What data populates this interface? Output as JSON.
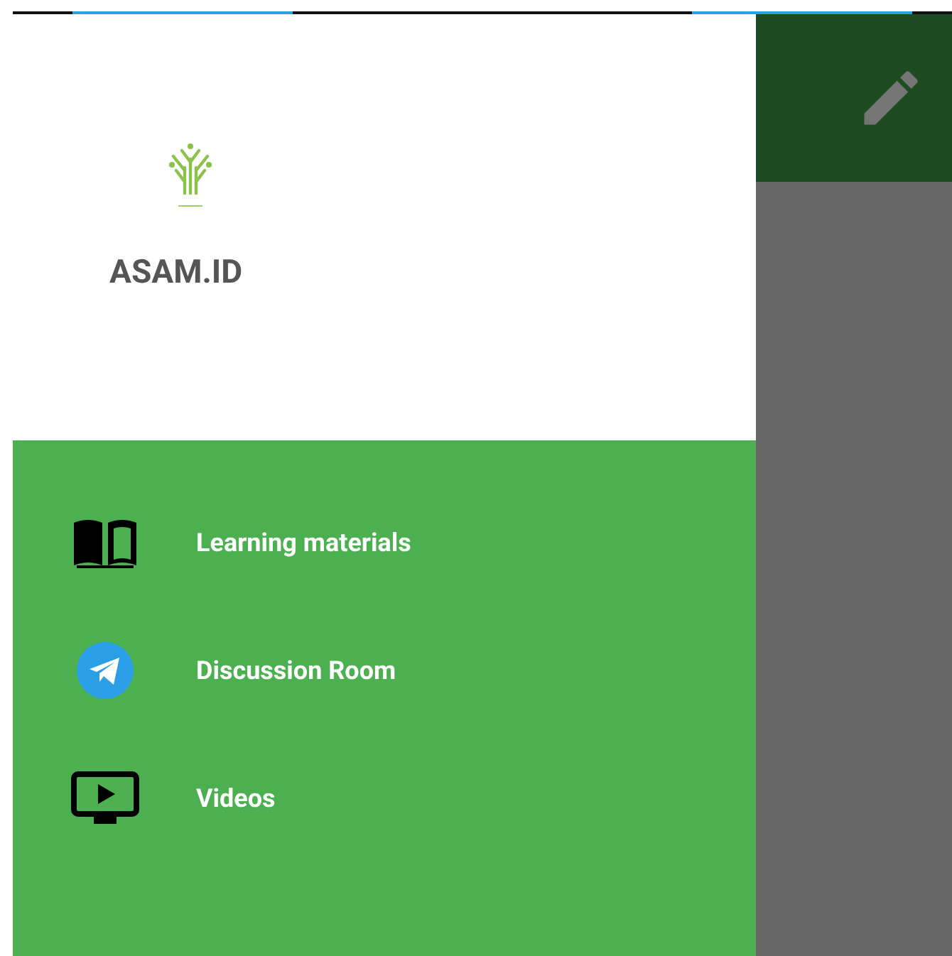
{
  "drawer": {
    "brand": "ASAM.ID",
    "items": [
      {
        "kind": "book",
        "label": "Learning materials"
      },
      {
        "kind": "telegram",
        "label": "Discussion Room"
      },
      {
        "kind": "video",
        "label": "Videos"
      }
    ]
  }
}
